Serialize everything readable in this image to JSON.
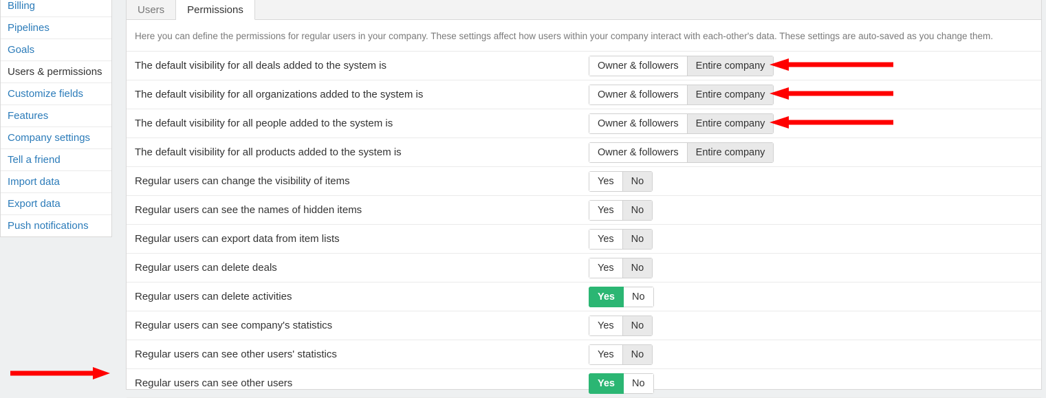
{
  "sidebar": {
    "items": [
      {
        "label": "Billing"
      },
      {
        "label": "Pipelines"
      },
      {
        "label": "Goals"
      },
      {
        "label": "Users & permissions"
      },
      {
        "label": "Customize fields"
      },
      {
        "label": "Features"
      },
      {
        "label": "Company settings"
      },
      {
        "label": "Tell a friend"
      },
      {
        "label": "Import data"
      },
      {
        "label": "Export data"
      },
      {
        "label": "Push notifications"
      }
    ],
    "active_index": 3
  },
  "tabs": {
    "items": [
      {
        "label": "Users"
      },
      {
        "label": "Permissions"
      }
    ],
    "active_index": 1
  },
  "intro": "Here you can define the permissions for regular users in your company. These settings affect how users within your company interact with each-other's data. These settings are auto-saved as you change them.",
  "visibility_options": {
    "a": "Owner & followers",
    "b": "Entire company"
  },
  "yesno_options": {
    "yes": "Yes",
    "no": "No"
  },
  "rows": [
    {
      "label": "The default visibility for all deals added to the system is",
      "type": "vis",
      "selected": "b",
      "arrow": true
    },
    {
      "label": "The default visibility for all organizations added to the system is",
      "type": "vis",
      "selected": "b",
      "arrow": true
    },
    {
      "label": "The default visibility for all people added to the system is",
      "type": "vis",
      "selected": "b",
      "arrow": true
    },
    {
      "label": "The default visibility for all products added to the system is",
      "type": "vis",
      "selected": "b",
      "arrow": false
    },
    {
      "label": "Regular users can change the visibility of items",
      "type": "yn",
      "selected": "no",
      "green": false
    },
    {
      "label": "Regular users can see the names of hidden items",
      "type": "yn",
      "selected": "no",
      "green": false
    },
    {
      "label": "Regular users can export data from item lists",
      "type": "yn",
      "selected": "no",
      "green": false
    },
    {
      "label": "Regular users can delete deals",
      "type": "yn",
      "selected": "no",
      "green": false
    },
    {
      "label": "Regular users can delete activities",
      "type": "yn",
      "selected": "yes",
      "green": true
    },
    {
      "label": "Regular users can see company's statistics",
      "type": "yn",
      "selected": "no",
      "green": false
    },
    {
      "label": "Regular users can see other users' statistics",
      "type": "yn",
      "selected": "no",
      "green": false
    },
    {
      "label": "Regular users can see other users",
      "type": "yn",
      "selected": "yes",
      "green": true,
      "sidearrow": true
    }
  ],
  "annotation": {
    "color": "#ff0000"
  }
}
